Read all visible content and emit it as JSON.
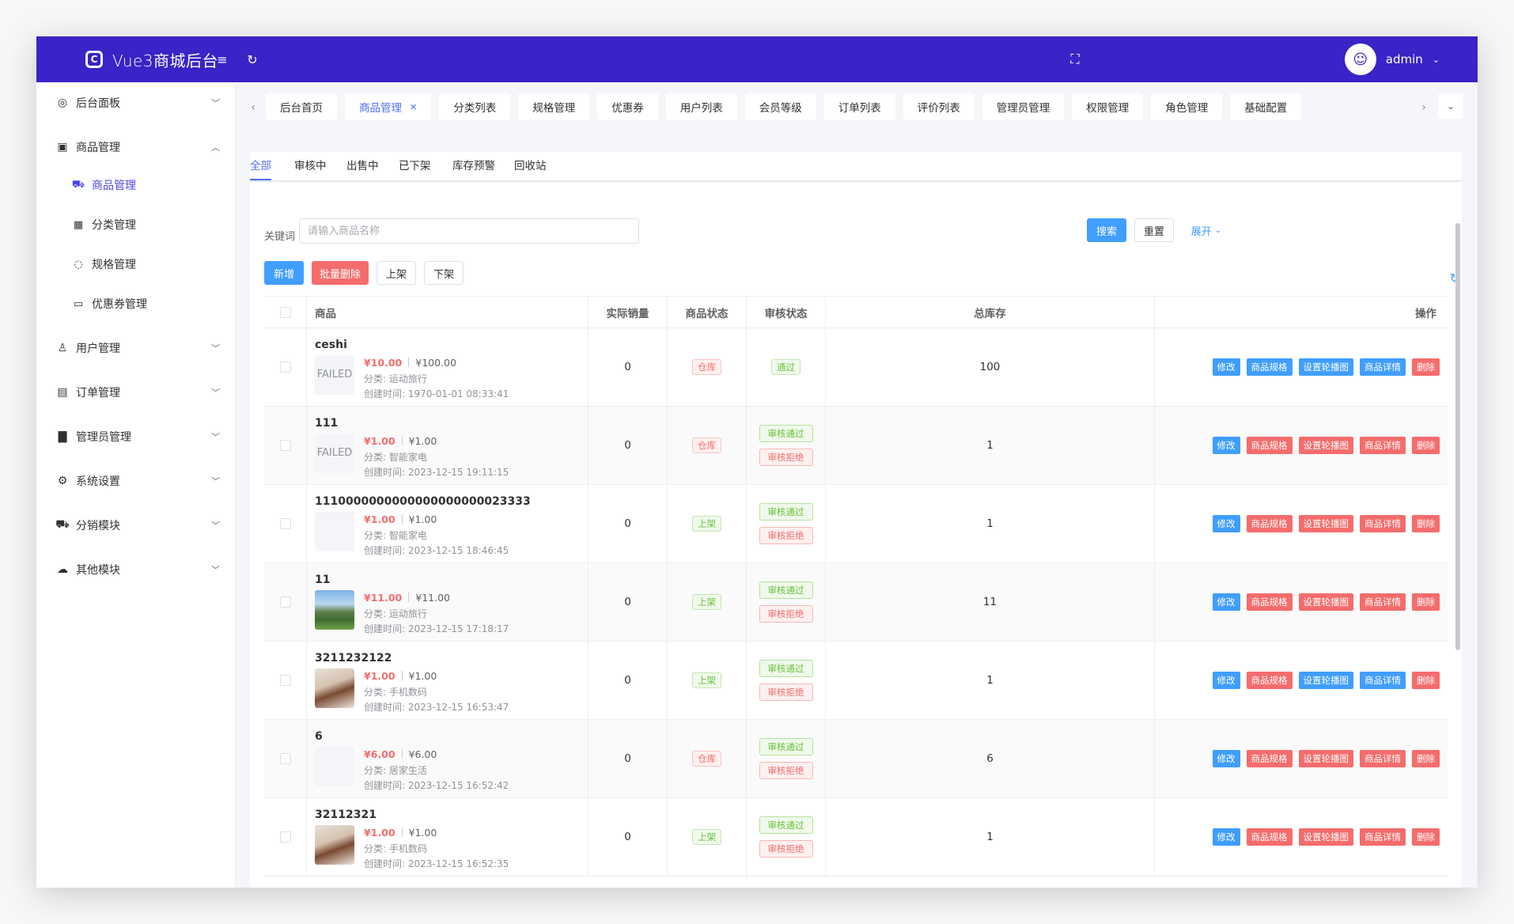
{
  "app": {
    "title": "Vue3商城后台",
    "logo_letter": "C",
    "user": "admin"
  },
  "sidebar": {
    "menus": [
      {
        "label": "后台面板",
        "icon": "dashboard-icon",
        "glyph": "◎",
        "expanded": false
      },
      {
        "label": "商品管理",
        "icon": "shopping-bag-icon",
        "glyph": "▣",
        "expanded": true,
        "children": [
          {
            "label": "商品管理",
            "icon": "cart-icon",
            "glyph": "⛟",
            "active": true
          },
          {
            "label": "分类管理",
            "icon": "grid-icon",
            "glyph": "▦"
          },
          {
            "label": "规格管理",
            "icon": "target-icon",
            "glyph": "◌"
          },
          {
            "label": "优惠券管理",
            "icon": "ticket-icon",
            "glyph": "▭"
          }
        ]
      },
      {
        "label": "用户管理",
        "icon": "user-icon",
        "glyph": "♙"
      },
      {
        "label": "订单管理",
        "icon": "box-icon",
        "glyph": "▤"
      },
      {
        "label": "管理员管理",
        "icon": "bar-chart-icon",
        "glyph": "▇"
      },
      {
        "label": "系统设置",
        "icon": "gear-icon",
        "glyph": "⚙"
      },
      {
        "label": "分销模块",
        "icon": "cart-icon",
        "glyph": "⛟"
      },
      {
        "label": "其他模块",
        "icon": "cloud-icon",
        "glyph": "☁"
      }
    ]
  },
  "tabs": [
    "后台首页",
    "商品管理",
    "分类列表",
    "规格管理",
    "优惠券",
    "用户列表",
    "会员等级",
    "订单列表",
    "评价列表",
    "管理员管理",
    "权限管理",
    "角色管理",
    "基础配置"
  ],
  "subtabs": [
    "全部",
    "审核中",
    "出售中",
    "已下架",
    "库存预警",
    "回收站"
  ],
  "search": {
    "label": "关键词",
    "placeholder": "请输入商品名称",
    "value": ""
  },
  "buttons": {
    "search": "搜索",
    "reset": "重置",
    "expand": "展开",
    "add": "新增",
    "batch_delete": "批量删除",
    "on_shelf": "上架",
    "off_shelf": "下架"
  },
  "table": {
    "headers": {
      "goods": "商品",
      "sales": "实际销量",
      "status": "商品状态",
      "audit": "审核状态",
      "stock": "总库存",
      "ops": "操作"
    },
    "ops": [
      "修改",
      "商品规格",
      "设置轮播图",
      "商品详情",
      "删除"
    ],
    "audit_pass": "审核通过",
    "audit_reject": "审核拒绝",
    "rows": [
      {
        "title": "ceshi",
        "img": "FAILED",
        "img_type": "failed",
        "price": "¥10.00",
        "orig": "¥100.00",
        "category": "分类: 运动旅行",
        "time": "创建时间: 1970-01-01 08:33:41",
        "sales": "0",
        "status": "仓库",
        "status_color": "red",
        "audit": "passed",
        "audit_text": "通过",
        "stock": "100"
      },
      {
        "title": "111",
        "img": "FAILED",
        "img_type": "failed",
        "price": "¥1.00",
        "orig": "¥1.00",
        "category": "分类: 智能家电",
        "time": "创建时间: 2023-12-15 19:11:15",
        "sales": "0",
        "status": "仓库",
        "status_color": "red",
        "audit": "pending",
        "stock": "1"
      },
      {
        "title": "1110000000000000000000023333",
        "img": "",
        "img_type": "blank",
        "price": "¥1.00",
        "orig": "¥1.00",
        "category": "分类: 智能家电",
        "time": "创建时间: 2023-12-15 18:46:45",
        "sales": "0",
        "status": "上架",
        "status_color": "green",
        "audit": "pending",
        "stock": "1"
      },
      {
        "title": "11",
        "img": "",
        "img_type": "landscape",
        "price": "¥11.00",
        "orig": "¥11.00",
        "category": "分类: 运动旅行",
        "time": "创建时间: 2023-12-15 17:18:17",
        "sales": "0",
        "status": "上架",
        "status_color": "green",
        "audit": "pending",
        "stock": "11"
      },
      {
        "title": "3211232122",
        "img": "",
        "img_type": "person",
        "price": "¥1.00",
        "orig": "¥1.00",
        "category": "分类: 手机数码",
        "time": "创建时间: 2023-12-15 16:53:47",
        "sales": "0",
        "status": "上架",
        "status_color": "green",
        "audit": "pending",
        "stock": "1"
      },
      {
        "title": "6",
        "img": "",
        "img_type": "blank",
        "price": "¥6.00",
        "orig": "¥6.00",
        "category": "分类: 居家生活",
        "time": "创建时间: 2023-12-15 16:52:42",
        "sales": "0",
        "status": "仓库",
        "status_color": "red",
        "audit": "pending",
        "stock": "6"
      },
      {
        "title": "32112321",
        "img": "",
        "img_type": "person",
        "price": "¥1.00",
        "orig": "¥1.00",
        "category": "分类: 手机数码",
        "time": "创建时间: 2023-12-15 16:52:35",
        "sales": "0",
        "status": "上架",
        "status_color": "green",
        "audit": "pending",
        "stock": "1"
      }
    ]
  },
  "colors": {
    "header": "#3a23c7",
    "primary": "#409eff",
    "danger": "#f56c6c",
    "success": "#67c23a",
    "active_menu": "#4f46e5"
  }
}
